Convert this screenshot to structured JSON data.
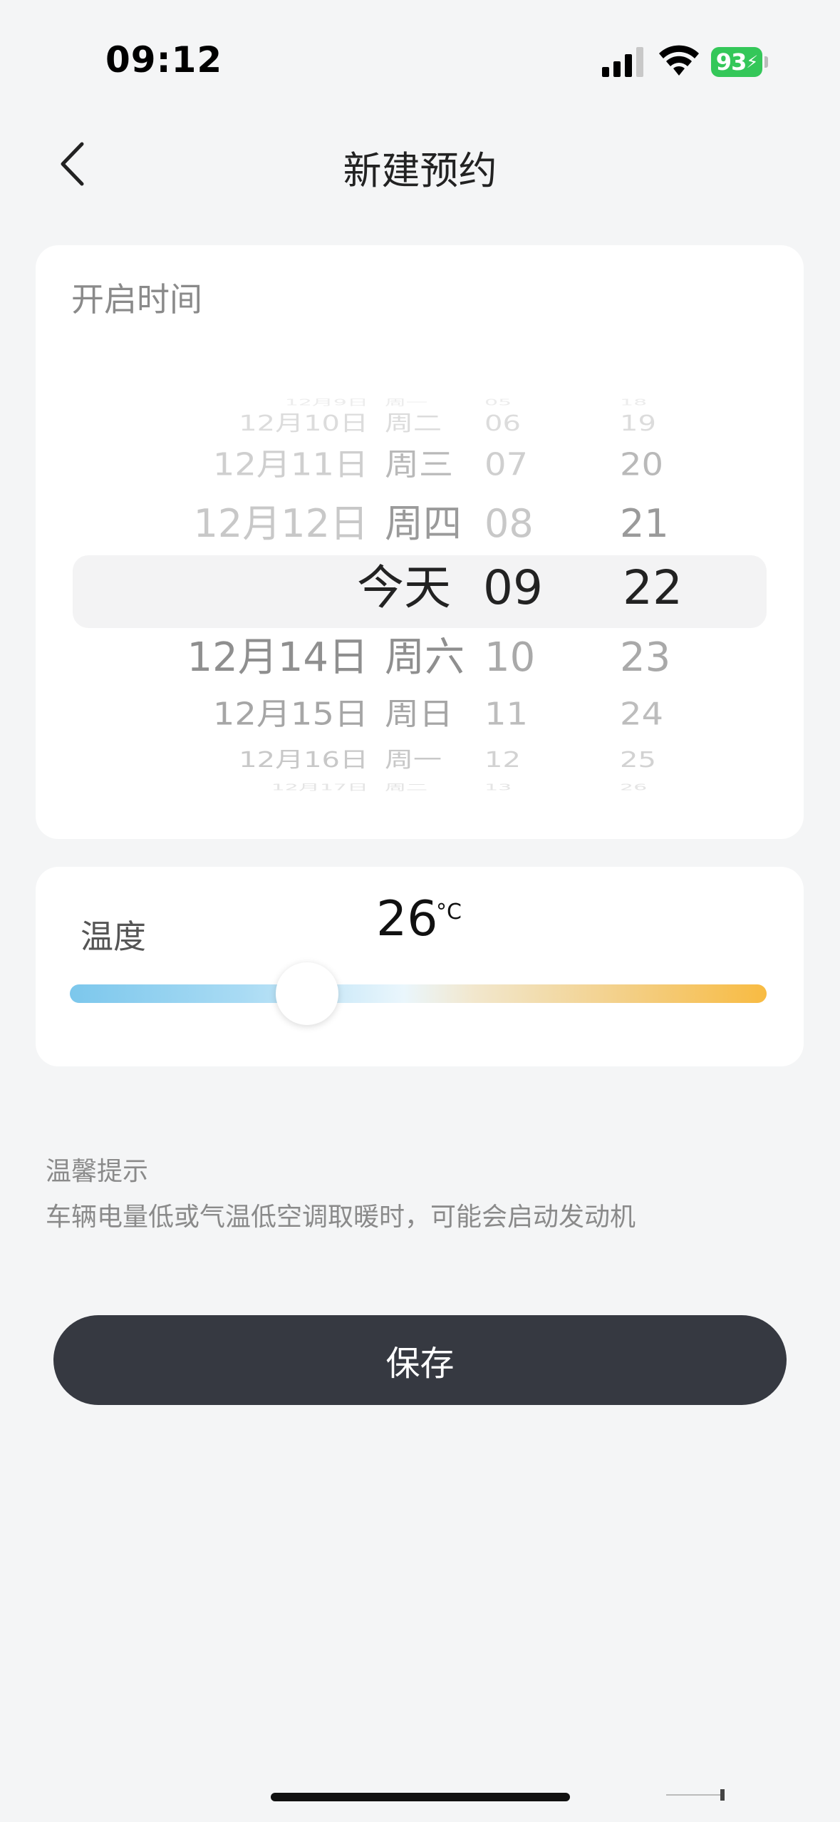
{
  "status_bar": {
    "time": "09:12",
    "battery": "93"
  },
  "header": {
    "title": "新建预约",
    "back_icon": "chevron-left-icon"
  },
  "time_card": {
    "label": "开启时间",
    "picker": {
      "rows_above": [
        {
          "date": "12月9日",
          "week": "周一",
          "hour": "05",
          "minute": "18"
        },
        {
          "date": "12月10日",
          "week": "周二",
          "hour": "06",
          "minute": "19"
        },
        {
          "date": "12月11日",
          "week": "周三",
          "hour": "07",
          "minute": "20"
        },
        {
          "date": "12月12日",
          "week": "周四",
          "hour": "08",
          "minute": "21"
        }
      ],
      "selected": {
        "date": "今天",
        "hour": "09",
        "minute": "22"
      },
      "rows_below": [
        {
          "date": "12月14日",
          "week": "周六",
          "hour": "10",
          "minute": "23"
        },
        {
          "date": "12月15日",
          "week": "周日",
          "hour": "11",
          "minute": "24"
        },
        {
          "date": "12月16日",
          "week": "周一",
          "hour": "12",
          "minute": "25"
        },
        {
          "date": "12月17日",
          "week": "周二",
          "hour": "13",
          "minute": "26"
        }
      ]
    }
  },
  "temperature_card": {
    "label": "温度",
    "value": "26",
    "unit": "°C",
    "slider_fraction": 0.34
  },
  "tips": {
    "title": "温馨提示",
    "text": "车辆电量低或气温低空调取暖时，可能会启动发动机"
  },
  "save_button": {
    "label": "保存",
    "color": "#363941"
  },
  "colors": {
    "background": "#f4f5f6",
    "card": "#ffffff",
    "battery": "#34c759",
    "slider_cold": "#7cc7ec",
    "slider_warm": "#f8bb42"
  }
}
